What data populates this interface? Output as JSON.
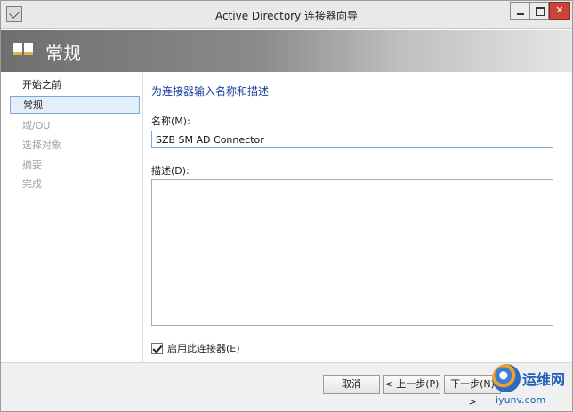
{
  "window": {
    "title": "Active Directory 连接器向导"
  },
  "banner": {
    "title": "常规"
  },
  "sidebar": {
    "items": [
      {
        "label": "开始之前",
        "state": "done"
      },
      {
        "label": "常规",
        "state": "active"
      },
      {
        "label": "域/OU",
        "state": "pending"
      },
      {
        "label": "选择对象",
        "state": "pending"
      },
      {
        "label": "摘要",
        "state": "pending"
      },
      {
        "label": "完成",
        "state": "pending"
      }
    ]
  },
  "content": {
    "heading": "为连接器输入名称和描述",
    "name_label": "名称(M):",
    "name_value": "SZB SM AD Connector",
    "description_label": "描述(D):",
    "description_value": "",
    "enable_checkbox": {
      "label": "启用此连接器(E)",
      "checked": true
    }
  },
  "footer": {
    "cancel_label": "取消",
    "back_label": "< 上一步(P)",
    "next_label": "下一步(N) >"
  },
  "watermark": {
    "brand": "运维网",
    "domain": "iyunv.com"
  },
  "colors": {
    "heading": "#1a3fa0",
    "active_item_bg": "#e4eefa",
    "active_item_border": "#7aa6d8",
    "close_button": "#c9453b"
  }
}
